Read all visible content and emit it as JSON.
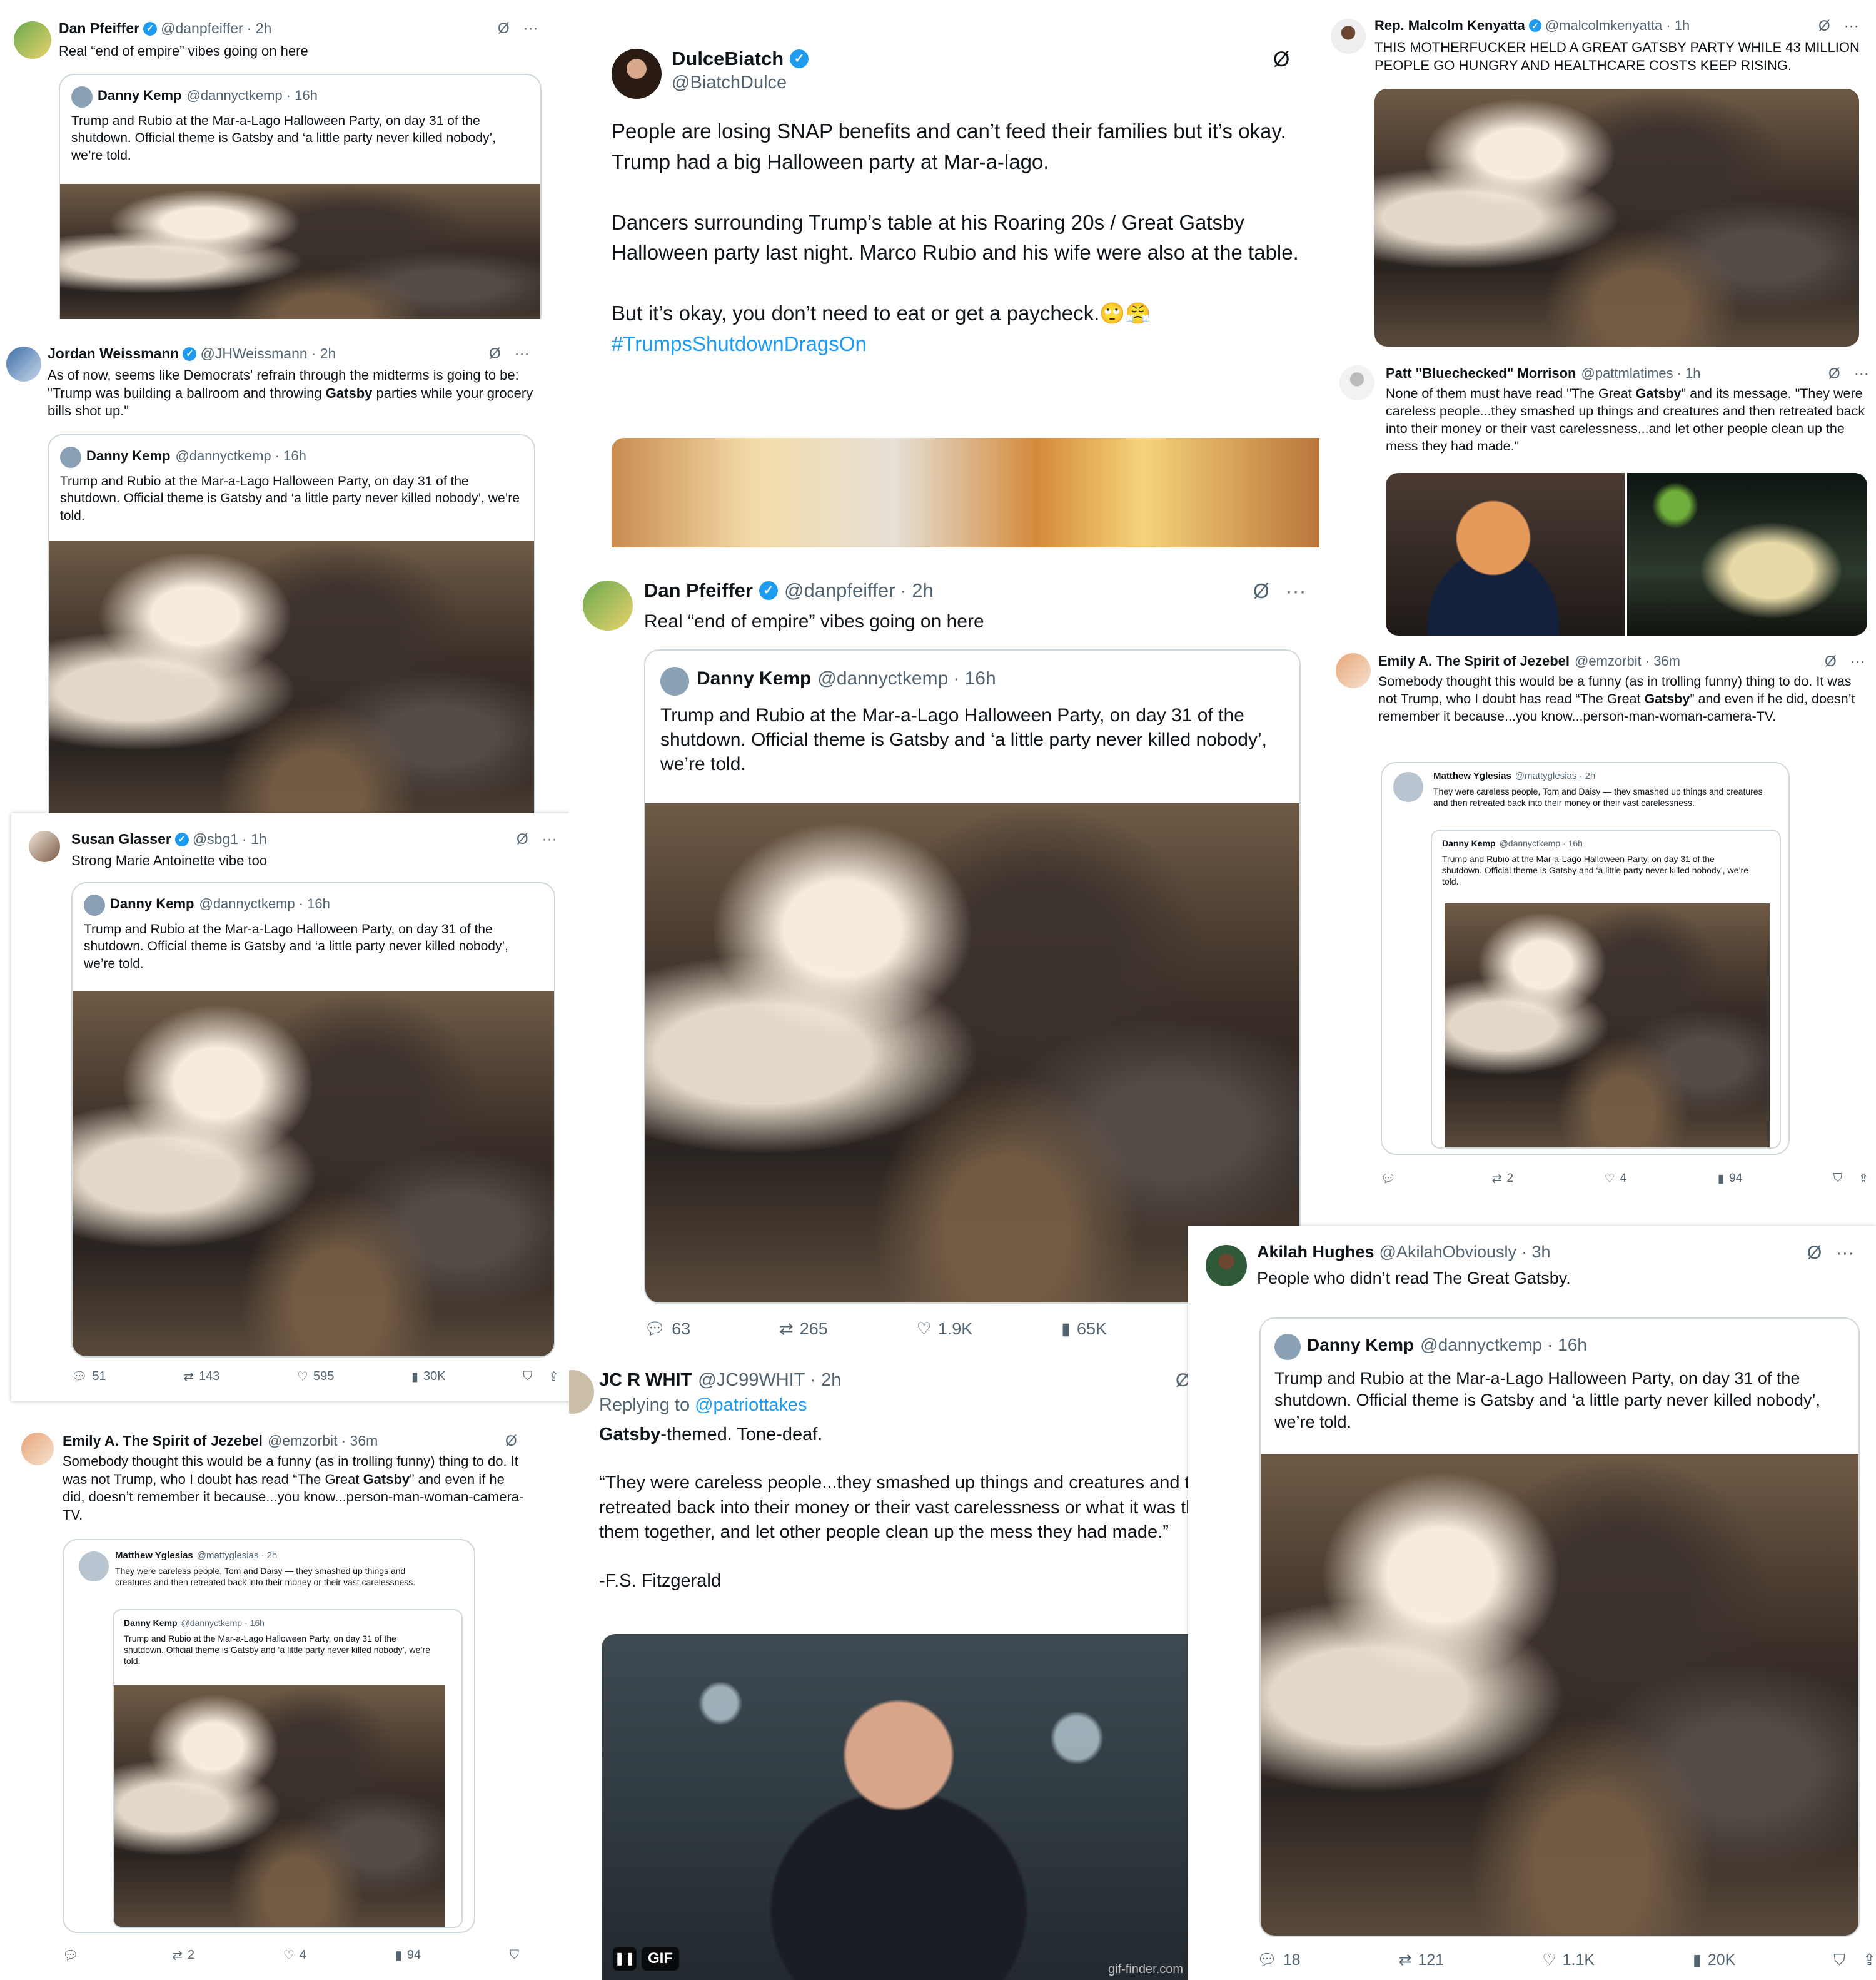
{
  "common": {
    "quoted_name": "Danny Kemp",
    "quoted_handle": "@dannyctkemp",
    "quoted_time": "· 16h",
    "quoted_text": "Trump and Rubio at the Mar-a-Lago Halloween Party, on day 31 of the shutdown. Official theme is Gatsby and ‘a little party never killed nobody’, we’re told.",
    "more": "···",
    "grok": "Ø",
    "verified": "✓"
  },
  "t1": {
    "name": "Dan Pfeiffer",
    "handle": "@danpfeiffer",
    "time": "· 2h",
    "text": "Real “end of empire” vibes going on here"
  },
  "t2": {
    "name": "Jordan Weissmann",
    "handle": "@JHWeissmann",
    "time": "· 2h",
    "text_a": "As of now, seems like Democrats' refrain through the midterms is going to be: \"Trump was building a ballroom and throwing ",
    "text_b": "Gatsby",
    "text_c": " parties while your grocery bills shot up.\""
  },
  "t3": {
    "name": "Susan Glasser",
    "handle": "@sbg1",
    "time": "· 1h",
    "text": "Strong Marie Antoinette vibe too",
    "replies": "51",
    "reposts": "143",
    "likes": "595",
    "views": "30K"
  },
  "t4": {
    "name": "Emily A. The Spirit of Jezebel",
    "handle": "@emzorbit",
    "time": "· 36m",
    "text_a": "Somebody thought this would be a funny (as in trolling funny) thing to do. It was not Trump, who I doubt has read “The Great ",
    "text_b": "Gatsby",
    "text_c": "” and even if he did, doesn’t remember it because...you know...person-man-woman-camera-TV.",
    "inner_name": "Matthew Yglesias",
    "inner_handle": "@mattyglesias",
    "inner_time": "· 2h",
    "inner_text": "They were careless people, Tom and Daisy — they smashed up things and creatures and then retreated back into their money or their vast carelessness.",
    "replies": "",
    "reposts": "2",
    "likes": "4",
    "views": "94"
  },
  "t5": {
    "name": "DulceBiatch",
    "handle": "@BiatchDulce",
    "p1": "People are losing SNAP benefits and can’t feed their families but it’s okay.",
    "p2": "Trump had a big Halloween party at Mar-a-lago.",
    "p3": "Dancers surrounding Trump’s table at his Roaring 20s / Great Gatsby Halloween party last night. Marco Rubio and his wife were also at the table.",
    "p4": "But it’s okay, you don’t need to eat or get a paycheck.🙄😤",
    "hashtag": "#TrumpsShutdownDragsOn"
  },
  "t6": {
    "name": "Dan Pfeiffer",
    "handle": "@danpfeiffer",
    "time": "· 2h",
    "text": "Real “end of empire” vibes going on here",
    "replies": "63",
    "reposts": "265",
    "likes": "1.9K",
    "views": "65K"
  },
  "t7": {
    "name": "JC R WHIT",
    "handle": "@JC99WHIT",
    "time": "· 2h",
    "replying": "Replying to ",
    "replying_handle": "@patriottakes",
    "line1_a": "Gatsby",
    "line1_b": "-themed. Tone-deaf.",
    "quote": "“They were careless people...they smashed up things and creatures and then retreated back into their money or their vast carelessness or what it was that kept them together, and let other people clean up the mess they had made.”",
    "author": "-F.S. Fitzgerald",
    "gif_badge": "GIF",
    "watermark": "gif-finder.com"
  },
  "t8": {
    "name": "Rep. Malcolm Kenyatta",
    "handle": "@malcolmkenyatta",
    "time": "· 1h",
    "text": "THIS MOTHERFUCKER HELD A GREAT GATSBY PARTY WHILE 43 MILLION PEOPLE GO HUNGRY AND HEALTHCARE COSTS KEEP RISING."
  },
  "t9": {
    "name": "Patt \"Bluechecked\" Morrison",
    "handle": "@pattmlatimes",
    "time": "· 1h",
    "text_a": "None of them must have read \"The Great ",
    "text_b": "Gatsby",
    "text_c": "\" and its message. \"They were careless people...they smashed up things and creatures and then retreated back into their money or their vast  carelessness...and let other people clean up the mess they had made.\""
  },
  "t10": {
    "name": "Akilah Hughes",
    "handle": "@AkilahObviously",
    "time": "· 3h",
    "text": "People who didn’t read The Great Gatsby.",
    "replies": "18",
    "reposts": "121",
    "likes": "1.1K",
    "views": "20K"
  },
  "colors": {
    "accent": "#1d9bf0",
    "text": "#0f1419",
    "muted": "#536471",
    "border": "#cfd9de"
  },
  "icons": [
    "reply-icon",
    "repost-icon",
    "like-icon",
    "views-icon",
    "bookmark-icon",
    "share-icon",
    "grok-icon",
    "more-icon",
    "verified-badge-icon",
    "pause-icon"
  ]
}
